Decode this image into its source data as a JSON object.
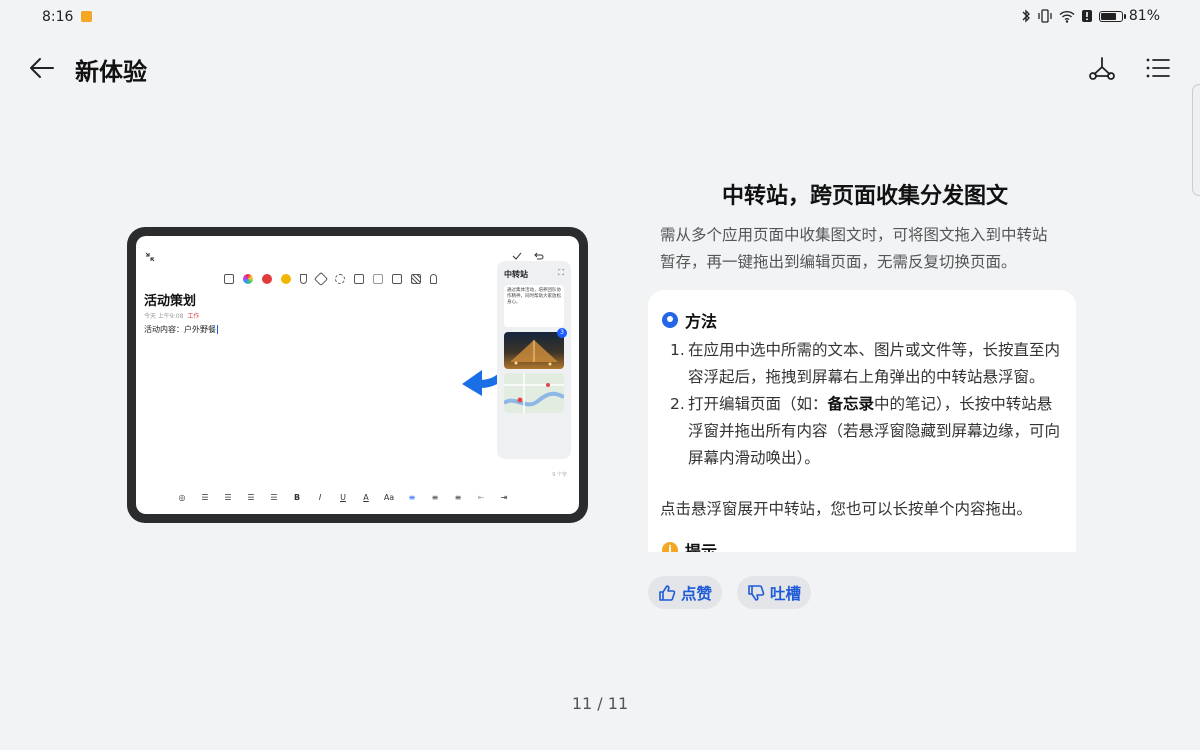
{
  "status_bar": {
    "time": "8:16",
    "battery": "81%",
    "battery_level": 0.81
  },
  "header": {
    "title": "新体验",
    "back_icon": "arrow-left-icon",
    "share_icon": "transfer-route-icon",
    "menu_icon": "list-menu-icon"
  },
  "illustration": {
    "note_title": "活动策划",
    "note_meta": "今天 上午9:08",
    "note_tag": "工作",
    "note_body": "活动内容：户外野餐",
    "hub_title": "中转站",
    "hub_text": "通过集体活动，培养团队协作精神，同时帮助大家放松身心。",
    "hub_count": "3",
    "word_count": "9 个字"
  },
  "feature": {
    "title": "中转站，跨页面收集分发图文",
    "description": "需从多个应用页面中收集图文时，可将图文拖入到中转站暂存，再一键拖出到编辑页面，无需反复切换页面。"
  },
  "method": {
    "heading": "方法",
    "step1_num": "1.",
    "step1_text": "在应用中选中所需的文本、图片或文件等，长按直至内容浮起后，拖拽到屏幕右上角弹出的中转站悬浮窗。",
    "step2_num": "2.",
    "step2_prefix": "打开编辑页面（如：",
    "step2_bold": "备忘录",
    "step2_suffix": "中的笔记），长按中转站悬浮窗并拖出所有内容（若悬浮窗隐藏到屏幕边缘，可向屏幕内滑动唤出）。",
    "note": "点击悬浮窗展开中转站，您也可以长按单个内容拖出。"
  },
  "tip": {
    "heading": "提示"
  },
  "feedback": {
    "like_label": "点赞",
    "dislike_label": "吐槽"
  },
  "pagination": {
    "indicator": "11 / 11"
  },
  "colors": {
    "accent": "#1f5bd8",
    "background": "#f1f3f5",
    "card": "#ffffff",
    "tip": "#f5a623"
  }
}
